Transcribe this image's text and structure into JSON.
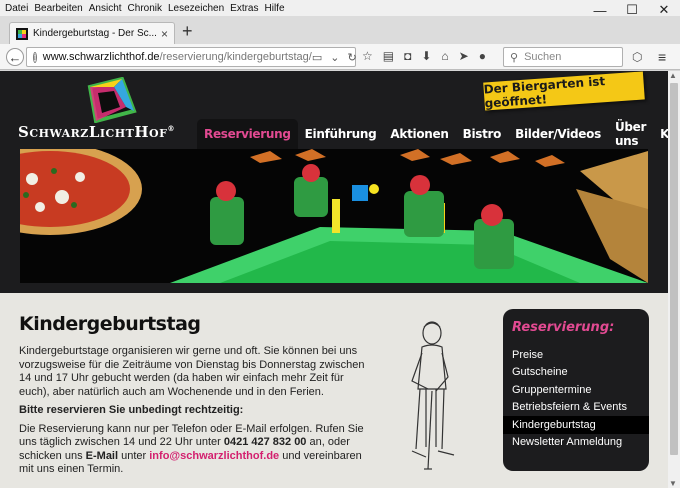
{
  "menubar": {
    "items": [
      "Datei",
      "Bearbeiten",
      "Ansicht",
      "Chronik",
      "Lesezeichen",
      "Extras",
      "Hilfe"
    ]
  },
  "window": {
    "minimize": "—",
    "maximize": "☐",
    "close": "✕"
  },
  "tab": {
    "title": "Kindergeburtstag - Der Sc...",
    "close": "×",
    "new_tab": "+"
  },
  "navbar": {
    "back": "←",
    "url_domain": "www.schwarzlichthof.de",
    "url_path": "/reservierung/kindergeburtstag/",
    "reload": "↻",
    "search_placeholder": "Suchen",
    "menu": "≡"
  },
  "site": {
    "logo_text": "SchwarzLichtHof",
    "logo_mark": "®",
    "banner": "Der Biergarten ist geöffnet!",
    "nav": [
      "Reservierung",
      "Einführung",
      "Aktionen",
      "Bistro",
      "Bilder/Videos",
      "Über uns",
      "Kontakt"
    ],
    "nav_active_index": 0,
    "colors": {
      "accent": "#e24a92",
      "header_bg": "#1c1c1e",
      "banner": "#f4c816"
    }
  },
  "content": {
    "title": "Kindergeburtstag",
    "p1": "Kindergeburtstage organisieren wir gerne und oft. Sie können bei uns vorzugsweise für die Zeiträume von Dienstag bis Donnerstag zwischen 14 und 17 Uhr gebucht werden (da haben wir einfach mehr Zeit für euch), aber natürlich auch am Wochenende und in den Ferien.",
    "p2": "Bitte reservieren Sie unbedingt rechtzeitig:",
    "p3_a": "Die Reservierung kann nur per Telefon oder E-Mail erfolgen. Rufen Sie uns täglich zwischen 14 und 22 Uhr unter ",
    "p3_phone": "0421 427 832 00",
    "p3_b": " an, oder schicken uns ",
    "p3_email_label": "E-Mail",
    "p3_c": " unter ",
    "p3_email": "info@schwarzlichthof.de",
    "p3_d": " und vereinbaren mit uns einen Termin."
  },
  "sidebar": {
    "title": "Reservierung:",
    "items": [
      "Preise",
      "Gutscheine",
      "Gruppentermine",
      "Betriebsfeiern & Events",
      "Kindergeburtstag",
      "Newsletter Anmeldung"
    ],
    "active_index": 4
  }
}
